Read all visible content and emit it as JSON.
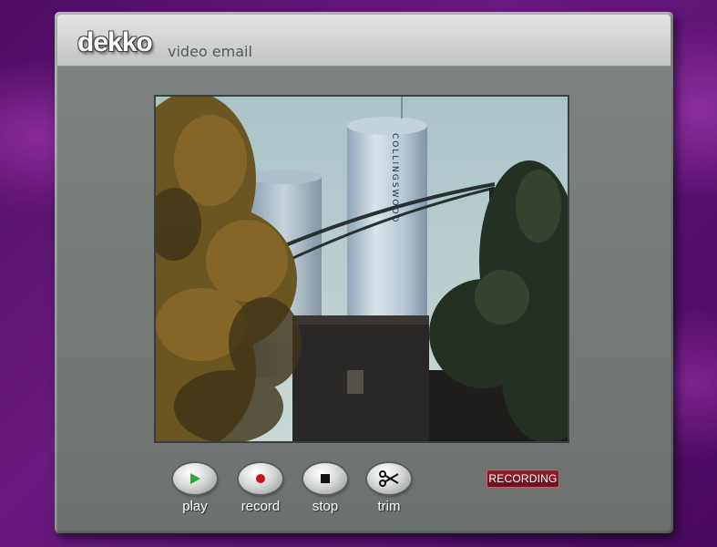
{
  "window": {
    "logo": "dekko",
    "subtitle": "video email"
  },
  "controls": [
    {
      "label": "play",
      "icon": "play-icon"
    },
    {
      "label": "record",
      "icon": "record-icon"
    },
    {
      "label": "stop",
      "icon": "stop-icon"
    },
    {
      "label": "trim",
      "icon": "scissors-icon"
    }
  ],
  "status": {
    "text": "RECORDING",
    "color": "#8c2030"
  },
  "colors": {
    "play_glyph": "#2fa83a",
    "record_glyph": "#c81420",
    "background": "#5c1270"
  }
}
